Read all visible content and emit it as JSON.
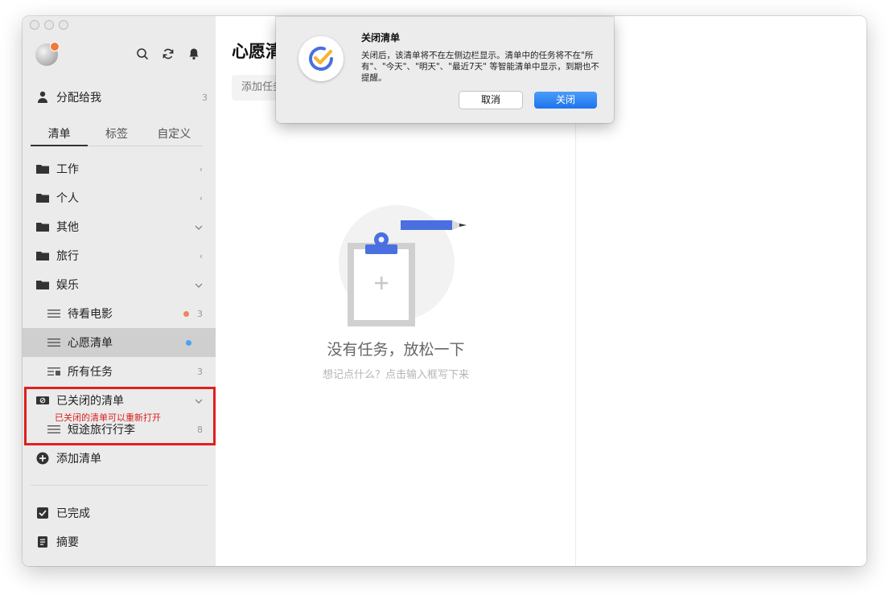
{
  "sidebar": {
    "avatar_name": "",
    "assigned": {
      "label": "分配给我",
      "count": "3"
    },
    "tabs": [
      "清单",
      "标签",
      "自定义"
    ],
    "rows": [
      {
        "label": "工作",
        "icon": "folder-icon",
        "indicator": "‹",
        "indicator_name": "collapse-left-icon"
      },
      {
        "label": "个人",
        "icon": "folder-icon",
        "indicator": "‹",
        "indicator_name": "collapse-left-icon"
      },
      {
        "label": "其他",
        "icon": "folder-icon",
        "indicator": "⌄",
        "indicator_name": "chevron-down-icon"
      },
      {
        "label": "旅行",
        "icon": "folder-icon",
        "indicator": "‹",
        "indicator_name": "collapse-left-icon"
      },
      {
        "label": "娱乐",
        "icon": "folder-icon",
        "indicator": "⌄",
        "indicator_name": "chevron-down-icon"
      },
      {
        "label": "待看电影",
        "icon": "list-icon",
        "dot_color": "#f0845c",
        "count": "3"
      },
      {
        "label": "心愿清单",
        "icon": "list-icon",
        "dot_color": "#4aa3f5",
        "count": ""
      },
      {
        "label": "所有任务",
        "icon": "all-tasks-icon",
        "count": "3"
      },
      {
        "label": "已关闭的清单",
        "icon": "archive-icon",
        "indicator": "⌄",
        "indicator_name": "chevron-down-icon"
      },
      {
        "label": "短途旅行行李",
        "icon": "list-icon",
        "count": "8"
      },
      {
        "label": "添加清单",
        "icon": "add-circle-icon"
      }
    ],
    "closed_note": "已关闭的清单可以重新打开",
    "bottom": [
      {
        "label": "已完成",
        "icon": "checkbox-icon"
      },
      {
        "label": "摘要",
        "icon": "summary-icon"
      }
    ]
  },
  "main": {
    "title": "心愿清单",
    "add_placeholder": "添加任务",
    "empty_title": "没有任务，放松一下",
    "empty_subtitle": "想记点什么？点击输入框写下来"
  },
  "dialog": {
    "title": "关闭清单",
    "message": "关闭后，该清单将不在左侧边栏显示。清单中的任务将不在\"所有\"、\"今天\"、\"明天\"、\"最近7天\" 等智能清单中显示，到期也不提醒。",
    "cancel": "取消",
    "confirm": "关闭"
  },
  "colors": {
    "accent": "#1d74ee",
    "highlight": "#e0201f",
    "selected_row": "#cfcfcf"
  }
}
